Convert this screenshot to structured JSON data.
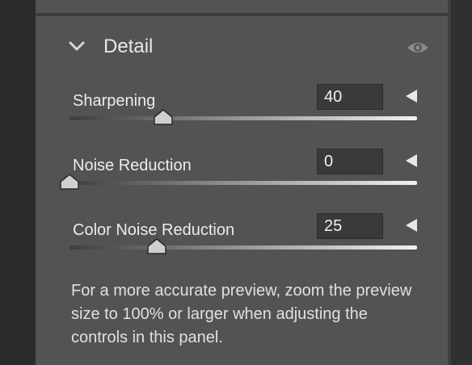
{
  "colors": {
    "panel_bg": "#535353",
    "gutter_bg": "#2b2b2b",
    "field_bg": "#3a3a3a",
    "icon": "#cfcfcf",
    "eye_icon": "#8a8a8a",
    "track_start": "#3e3e3e",
    "track_end": "#f2f2f2"
  },
  "section": {
    "title": "Detail",
    "expanded": true,
    "toggle_icon": "chevron-down-icon",
    "visibility_icon": "eye-icon"
  },
  "controls": [
    {
      "label": "Sharpening",
      "value": "40",
      "fraction": 0.27
    },
    {
      "label": "Noise Reduction",
      "value": "0",
      "fraction": 0.0
    },
    {
      "label": "Color Noise Reduction",
      "value": "25",
      "fraction": 0.25
    }
  ],
  "hint": "For a more accurate preview, zoom the preview size to 100% or larger when adjusting the controls in this panel."
}
